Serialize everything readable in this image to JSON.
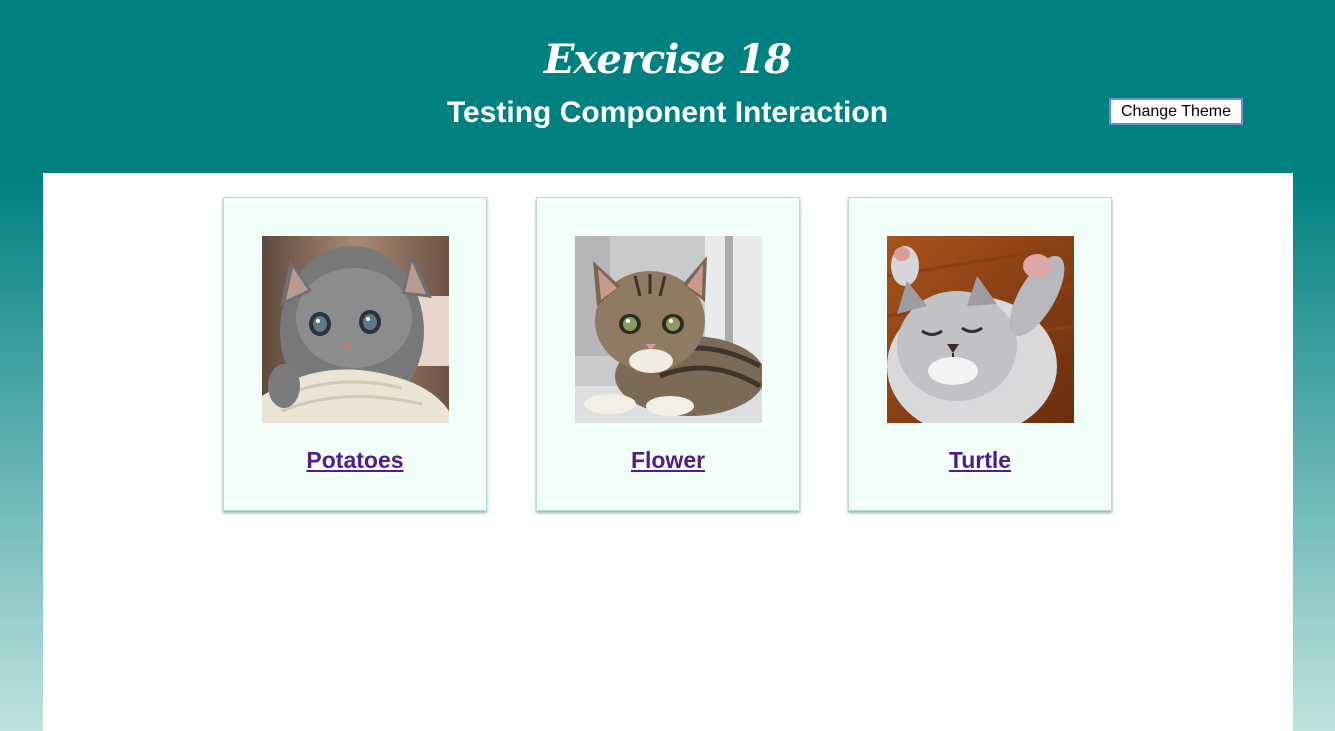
{
  "header": {
    "title": "Exercise 18",
    "subtitle": "Testing Component Interaction",
    "theme_button_label": "Change Theme"
  },
  "cards": [
    {
      "name": "Potatoes",
      "image": "kitten-gray-fluffy"
    },
    {
      "name": "Flower",
      "image": "kitten-tabby-window"
    },
    {
      "name": "Turtle",
      "image": "kitten-sleeping-paws-up"
    }
  ],
  "colors": {
    "header_bg": "#008080",
    "link": "#551a8b",
    "card_bg": "#f2fff9"
  }
}
